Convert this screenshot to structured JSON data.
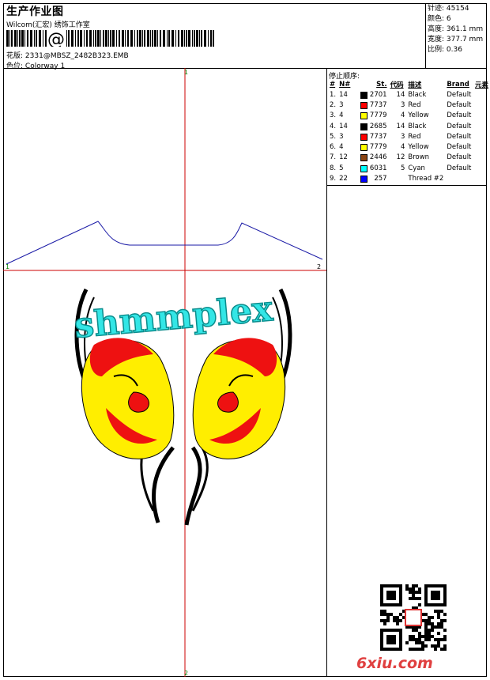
{
  "header": {
    "title": "生产作业图",
    "company": "Wilcom(汇宏) 绣饰工作室",
    "design_label": "花版:",
    "design_value": "2331@MBSZ_2482B323.EMB",
    "colorway_label": "色位:",
    "colorway_value": "Colorway 1"
  },
  "stats": [
    {
      "label": "针迹:",
      "value": "45154"
    },
    {
      "label": "颜色:",
      "value": "6"
    },
    {
      "label": "高度:",
      "value": "361.1 mm"
    },
    {
      "label": "宽度:",
      "value": "377.7 mm"
    },
    {
      "label": "比例:",
      "value": "0.36"
    }
  ],
  "stop_sequence": {
    "title": "停止顺序:",
    "columns": [
      "#",
      "N#",
      "St.",
      "代码",
      "描述",
      "Brand",
      "元素"
    ],
    "rows": [
      {
        "idx": "1.",
        "n": "14",
        "color": "#000000",
        "st": "2701",
        "code": "14",
        "desc": "Black",
        "brand": "Default"
      },
      {
        "idx": "2.",
        "n": "3",
        "color": "#ff0000",
        "st": "7737",
        "code": "3",
        "desc": "Red",
        "brand": "Default"
      },
      {
        "idx": "3.",
        "n": "4",
        "color": "#ffff00",
        "st": "7779",
        "code": "4",
        "desc": "Yellow",
        "brand": "Default"
      },
      {
        "idx": "4.",
        "n": "14",
        "color": "#000000",
        "st": "2685",
        "code": "14",
        "desc": "Black",
        "brand": "Default"
      },
      {
        "idx": "5.",
        "n": "3",
        "color": "#ff0000",
        "st": "7737",
        "code": "3",
        "desc": "Red",
        "brand": "Default"
      },
      {
        "idx": "6.",
        "n": "4",
        "color": "#ffff00",
        "st": "7779",
        "code": "4",
        "desc": "Yellow",
        "brand": "Default"
      },
      {
        "idx": "7.",
        "n": "12",
        "color": "#8b4513",
        "st": "2446",
        "code": "12",
        "desc": "Brown",
        "brand": "Default"
      },
      {
        "idx": "8.",
        "n": "5",
        "color": "#00ffff",
        "st": "6031",
        "code": "5",
        "desc": "Cyan",
        "brand": "Default"
      },
      {
        "idx": "9.",
        "n": "22",
        "color": "#0000ff",
        "st": "257",
        "code": "",
        "desc": "Thread #2",
        "brand": ""
      }
    ]
  },
  "design_text": "shmmplex",
  "guides": {
    "top": "1",
    "bottom": "2",
    "left": "1",
    "right": "2"
  },
  "watermark": "6xiu.com",
  "colors": {
    "guide_red": "#cc0000",
    "outline_blue": "#1a1aa6",
    "cyan": "#33e6e6",
    "yellow": "#ffee00",
    "red": "#ee1111",
    "black": "#000000"
  }
}
